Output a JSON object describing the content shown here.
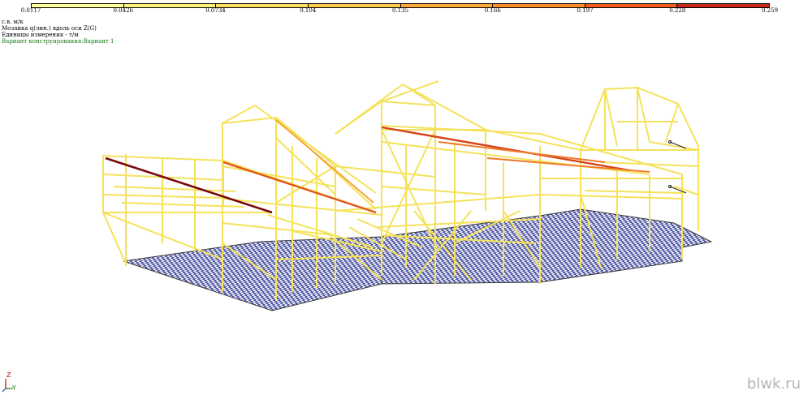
{
  "legend": {
    "ticks": [
      "0.0117",
      "0.0426",
      "0.0734",
      "0.104",
      "0.135",
      "0.166",
      "0.197",
      "0.228",
      "0.259"
    ],
    "colors": [
      "#ffff99",
      "#fff27a",
      "#ffe05e",
      "#ffc94a",
      "#ffaa38",
      "#ff8a2a",
      "#f25c1e",
      "#c8281a",
      "#7a0a0a"
    ]
  },
  "info": {
    "units_line": "с.в. м/к",
    "mosaic_line": "Мозаика q(лин.) вдоль оси  Z(G)",
    "measure_line": "Единицы измерения - т/м",
    "variant_line": "Вариант конструирования:Вариант 1"
  },
  "axes": {
    "z_label": "Z",
    "y_label": "Y"
  },
  "watermark": "blwk.ru",
  "colors": {
    "frame": "#f5e25a",
    "slab_mesh": "#1f2a8c",
    "slab_border": "#3a3a3a",
    "high_load": "#e0561c",
    "max_load": "#7a0a0a",
    "variant_text": "#1a7a1a"
  },
  "icons": [
    "z-axis-icon",
    "y-axis-icon",
    "x-axis-icon"
  ]
}
